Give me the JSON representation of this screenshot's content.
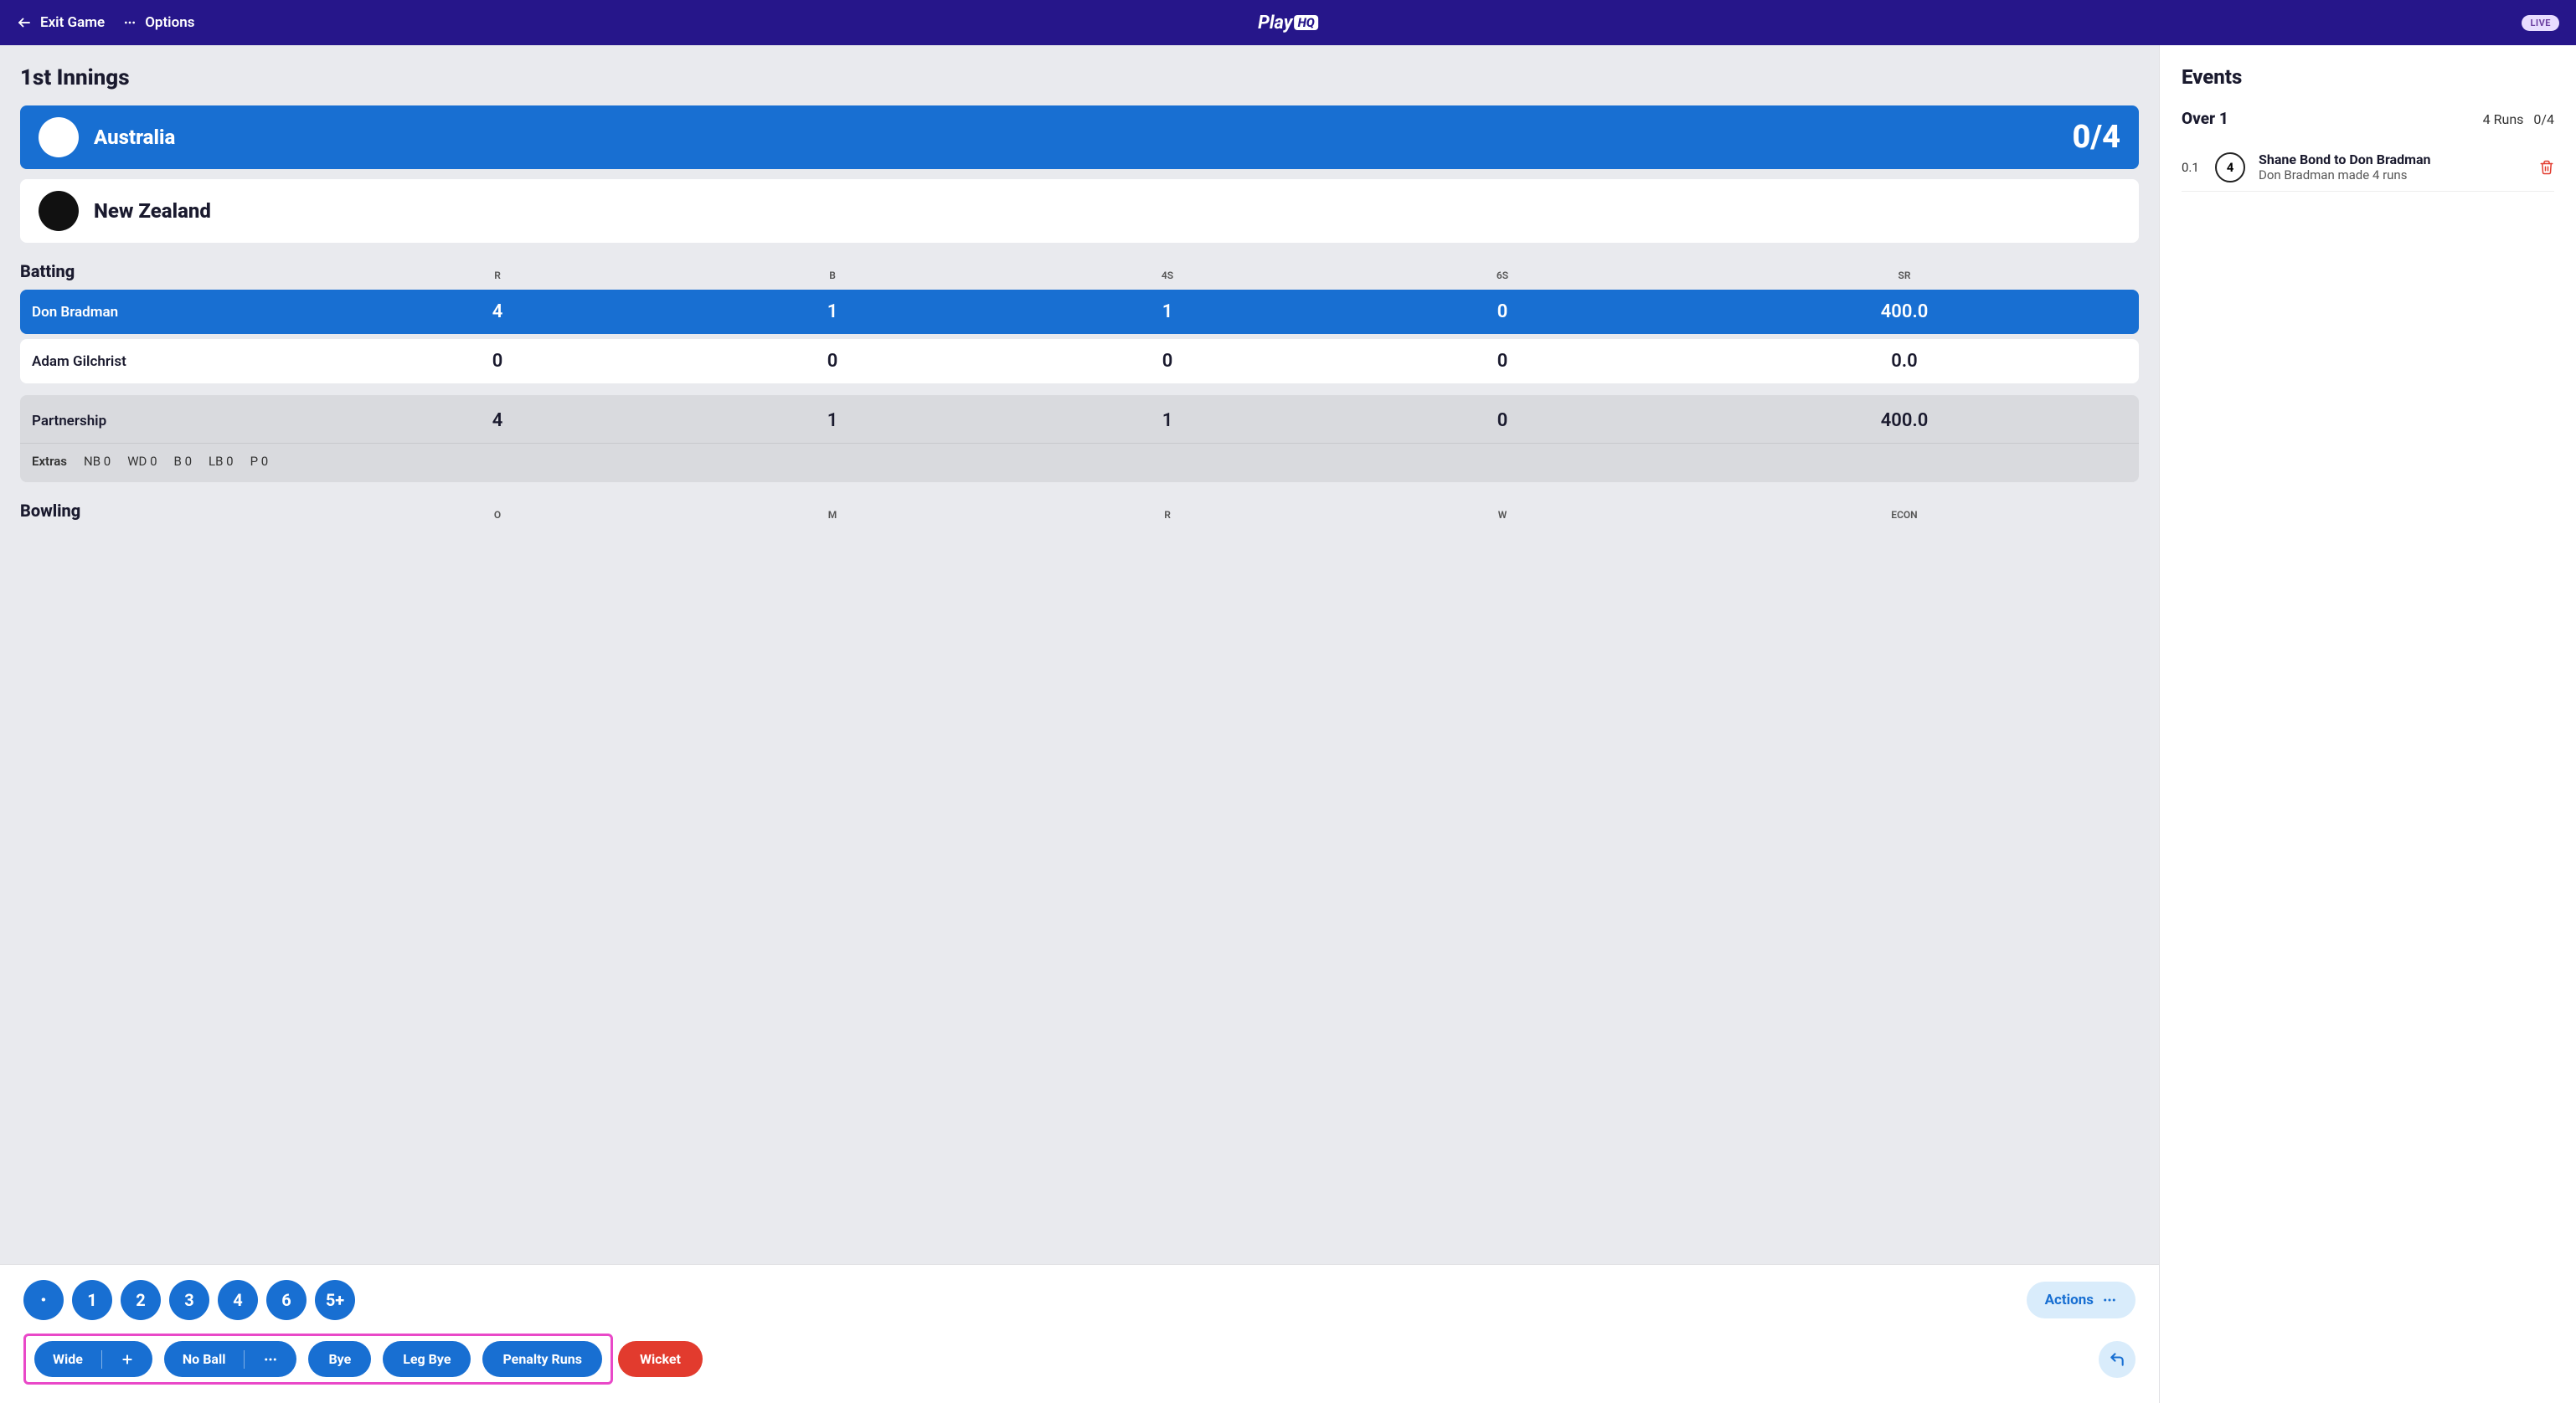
{
  "topbar": {
    "exit": "Exit Game",
    "options": "Options",
    "logo_play": "Play",
    "logo_hq": "HQ",
    "live": "LIVE"
  },
  "innings_title": "1st Innings",
  "teams": {
    "batting": {
      "name": "Australia",
      "score": "0/4"
    },
    "bowling": {
      "name": "New Zealand"
    }
  },
  "batting": {
    "title": "Batting",
    "cols": {
      "r": "R",
      "b": "B",
      "fours": "4S",
      "sixes": "6S",
      "sr": "SR"
    },
    "rows": [
      {
        "name": "Don Bradman",
        "r": "4",
        "b": "1",
        "fours": "1",
        "sixes": "0",
        "sr": "400.0"
      },
      {
        "name": "Adam Gilchrist",
        "r": "0",
        "b": "0",
        "fours": "0",
        "sixes": "0",
        "sr": "0.0"
      }
    ],
    "partnership": {
      "label": "Partnership",
      "r": "4",
      "b": "1",
      "fours": "1",
      "sixes": "0",
      "sr": "400.0"
    },
    "extras": {
      "label": "Extras",
      "nb": "NB 0",
      "wd": "WD 0",
      "b": "B 0",
      "lb": "LB 0",
      "p": "P 0"
    }
  },
  "bowling": {
    "title": "Bowling",
    "cols": {
      "o": "O",
      "m": "M",
      "r": "R",
      "w": "W",
      "econ": "ECON"
    }
  },
  "controls": {
    "runs": [
      "·",
      "1",
      "2",
      "3",
      "4",
      "6",
      "5+"
    ],
    "actions": "Actions",
    "wide": "Wide",
    "noball": "No Ball",
    "bye": "Bye",
    "legbye": "Leg Bye",
    "penalty": "Penalty Runs",
    "wicket": "Wicket"
  },
  "events": {
    "title": "Events",
    "over": {
      "label": "Over 1",
      "runs": "4 Runs",
      "score": "0/4"
    },
    "items": [
      {
        "ball": "0.1",
        "badge": "4",
        "title": "Shane Bond to Don Bradman",
        "sub": "Don Bradman made 4 runs"
      }
    ]
  }
}
